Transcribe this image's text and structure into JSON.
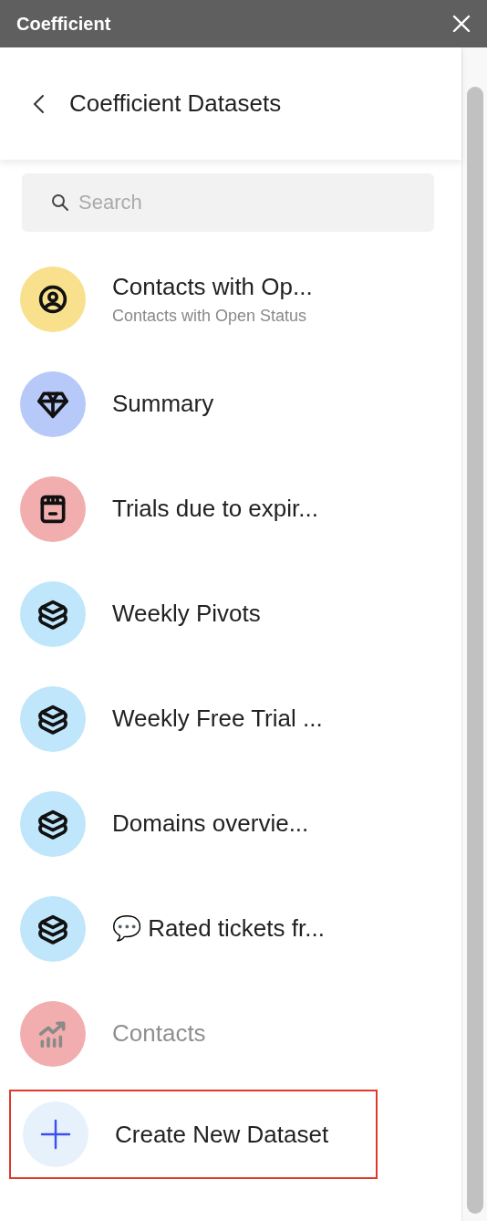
{
  "window": {
    "title": "Coefficient"
  },
  "header": {
    "title": "Coefficient Datasets"
  },
  "search": {
    "placeholder": "Search"
  },
  "datasets": [
    {
      "title": "Contacts with Op...",
      "subtitle": "Contacts with Open Status",
      "kind": "person",
      "color": "#f9e08c",
      "disabled": false
    },
    {
      "title": "Summary",
      "kind": "diamond",
      "color": "#b7c9f9",
      "disabled": false
    },
    {
      "title": "Trials due to expir...",
      "kind": "calendar",
      "color": "#f2aeae",
      "disabled": false
    },
    {
      "title": "Weekly Pivots",
      "kind": "stack",
      "color": "#bfe6fb",
      "disabled": false
    },
    {
      "title": "Weekly Free Trial ...",
      "kind": "stack",
      "color": "#bfe6fb",
      "disabled": false
    },
    {
      "title": "Domains overvie...",
      "kind": "stack",
      "color": "#bfe6fb",
      "disabled": false
    },
    {
      "title": "💬 Rated tickets fr...",
      "kind": "stack",
      "color": "#bfe6fb",
      "disabled": false
    },
    {
      "title": "Contacts",
      "kind": "chart",
      "color": "#f2aeae",
      "disabled": true
    }
  ],
  "create": {
    "label": "Create New Dataset",
    "highlighted": true
  }
}
